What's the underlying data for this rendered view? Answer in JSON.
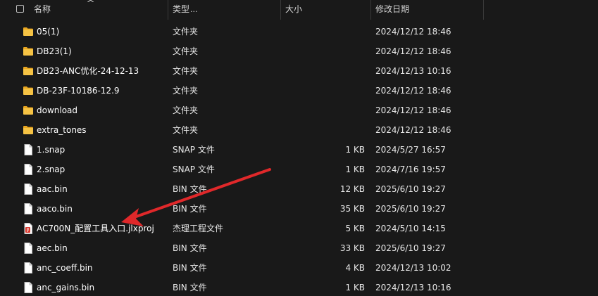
{
  "header": {
    "name_label": "名称",
    "type_label": "类型",
    "type_ellipsis": "...",
    "size_label": "大小",
    "date_label": "修改日期"
  },
  "colors": {
    "background": "#191919",
    "folder": "#f6c344",
    "arrow": "#e0282a"
  },
  "files": [
    {
      "name": "05(1)",
      "type": "文件夹",
      "size": "",
      "date": "2024/12/12 18:46",
      "icon": "folder-icon"
    },
    {
      "name": "DB23(1)",
      "type": "文件夹",
      "size": "",
      "date": "2024/12/12 18:46",
      "icon": "folder-icon"
    },
    {
      "name": "DB23-ANC优化-24-12-13",
      "type": "文件夹",
      "size": "",
      "date": "2024/12/13 10:16",
      "icon": "folder-icon"
    },
    {
      "name": "DB-23F-10186-12.9",
      "type": "文件夹",
      "size": "",
      "date": "2024/12/12 18:46",
      "icon": "folder-icon"
    },
    {
      "name": "download",
      "type": "文件夹",
      "size": "",
      "date": "2024/12/12 18:46",
      "icon": "folder-icon"
    },
    {
      "name": "extra_tones",
      "type": "文件夹",
      "size": "",
      "date": "2024/12/12 18:46",
      "icon": "folder-icon"
    },
    {
      "name": "1.snap",
      "type": "SNAP 文件",
      "size": "1 KB",
      "date": "2024/5/27 16:57",
      "icon": "file-icon"
    },
    {
      "name": "2.snap",
      "type": "SNAP 文件",
      "size": "1 KB",
      "date": "2024/7/16 19:57",
      "icon": "file-icon"
    },
    {
      "name": "aac.bin",
      "type": "BIN 文件",
      "size": "12 KB",
      "date": "2025/6/10 19:27",
      "icon": "file-icon"
    },
    {
      "name": "aaco.bin",
      "type": "BIN 文件",
      "size": "35 KB",
      "date": "2025/6/10 19:27",
      "icon": "file-icon"
    },
    {
      "name": "AC700N_配置工具入口.jlxproj",
      "type": "杰理工程文件",
      "size": "5 KB",
      "date": "2024/5/10 14:15",
      "icon": "project-file-icon"
    },
    {
      "name": "aec.bin",
      "type": "BIN 文件",
      "size": "33 KB",
      "date": "2025/6/10 19:27",
      "icon": "file-icon"
    },
    {
      "name": "anc_coeff.bin",
      "type": "BIN 文件",
      "size": "4 KB",
      "date": "2024/12/13 10:02",
      "icon": "file-icon"
    },
    {
      "name": "anc_gains.bin",
      "type": "BIN 文件",
      "size": "1 KB",
      "date": "2024/12/13 10:16",
      "icon": "file-icon"
    }
  ]
}
